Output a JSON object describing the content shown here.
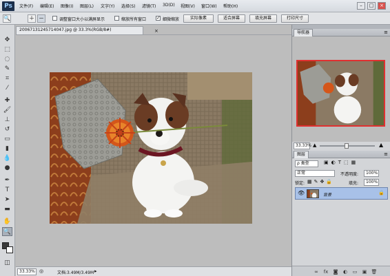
{
  "app": {
    "logo": "Ps"
  },
  "menu": [
    "文件(F)",
    "编辑(E)",
    "图像(I)",
    "图层(L)",
    "文字(Y)",
    "选择(S)",
    "滤镜(T)",
    "3D(D)",
    "视图(V)",
    "窗口(W)",
    "帮助(H)"
  ],
  "window_controls": {
    "minimize": "–",
    "maximize": "□",
    "close": "×"
  },
  "options": {
    "resize_windows_label": "调整窗口大小以满屏显示",
    "resize_windows_checked": false,
    "zoom_all_label": "缩放所有窗口",
    "zoom_all_checked": false,
    "scrubby_label": "细微缩放",
    "scrubby_checked": true,
    "actual_pixels": "实际像素",
    "fit_screen": "适合屏幕",
    "fill_screen": "填充屏幕",
    "print_size": "打印尺寸"
  },
  "document": {
    "tab_title": "20067131245714047.jpg @ 33.3%(RGB/8#)",
    "close": "×",
    "zoom": "33.33%",
    "doc_info": "文档:3.49M/3.49M"
  },
  "navigator": {
    "tab": "导航器",
    "zoom": "33.33%"
  },
  "layers": {
    "tab": "图层",
    "kind_label": "ρ 类型",
    "blend_mode": "正常",
    "opacity_label": "不透明度:",
    "opacity": "100%",
    "lock_label": "锁定:",
    "fill_label": "填充:",
    "fill": "100%",
    "layer_name": "背景",
    "lock_icon": "🔒"
  },
  "colors": {
    "accent_nav_frame": "#e03030",
    "layer_selected": "#a8c1e8"
  }
}
